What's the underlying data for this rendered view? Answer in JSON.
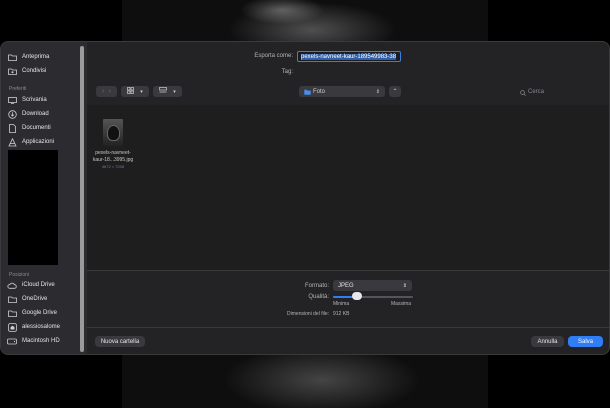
{
  "sidebar": {
    "items_top": [
      {
        "label": "Anteprima",
        "icon": "folder-icon"
      },
      {
        "label": "Condivisi",
        "icon": "shared-folder-icon"
      }
    ],
    "favorites_title": "Preferiti",
    "favorites": [
      {
        "label": "Scrivania",
        "icon": "desktop-icon"
      },
      {
        "label": "Download",
        "icon": "download-icon"
      },
      {
        "label": "Documenti",
        "icon": "document-icon"
      },
      {
        "label": "Applicazioni",
        "icon": "applications-icon"
      }
    ],
    "locations_title": "Posizioni",
    "locations": [
      {
        "label": "iCloud Drive",
        "icon": "cloud-icon"
      },
      {
        "label": "OneDrive",
        "icon": "folder-icon"
      },
      {
        "label": "Google Drive",
        "icon": "folder-icon"
      },
      {
        "label": "alessiosalome",
        "icon": "home-icon"
      },
      {
        "label": "Macintosh HD",
        "icon": "disk-icon"
      }
    ]
  },
  "header": {
    "export_as_label": "Esporta come:",
    "export_as_value": "pexels-navneet-kaur-189549983-38",
    "tag_label": "Tag:",
    "location": "Foto"
  },
  "search": {
    "placeholder": "Cerca"
  },
  "file": {
    "name_line1": "pexels-navneet-",
    "name_line2": "kaur-18...3995.jpg",
    "dimensions": "4672 × 7008"
  },
  "options": {
    "format_label": "Formato:",
    "format_value": "JPEG",
    "quality_label": "Qualità:",
    "quality_min": "Minima",
    "quality_max": "Massima",
    "quality_fraction": 0.3,
    "filesize_label": "Dimensioni del file:",
    "filesize_value": "912 KB"
  },
  "buttons": {
    "new_folder": "Nuova cartella",
    "cancel": "Annulla",
    "save": "Salva"
  },
  "colors": {
    "accent": "#2f7ef5",
    "field_focus": "#3a7de0"
  }
}
